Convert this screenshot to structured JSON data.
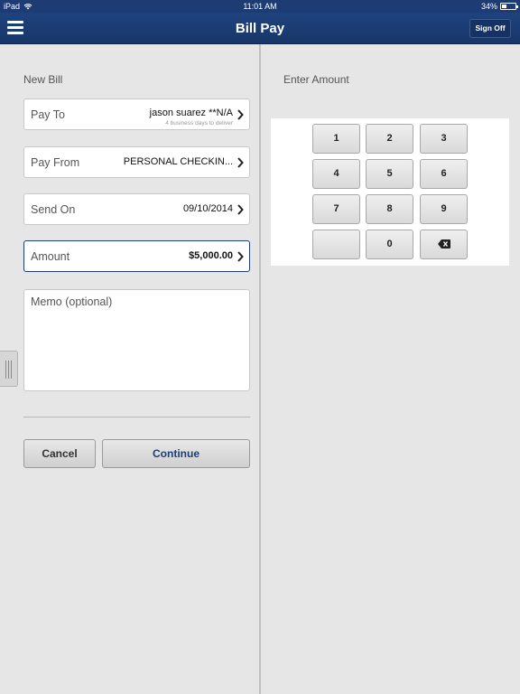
{
  "status_bar": {
    "device": "iPad",
    "time": "11:01 AM",
    "battery_text": "34%",
    "battery_level": 0.34
  },
  "nav": {
    "title": "Bill Pay",
    "sign_off": "Sign Off"
  },
  "left": {
    "section_title": "New Bill",
    "fields": [
      {
        "label": "Pay To",
        "value": "jason suarez **N/A",
        "sub": "4 business days to deliver"
      },
      {
        "label": "Pay From",
        "value": "PERSONAL CHECKIN..."
      },
      {
        "label": "Send On",
        "value": "09/10/2014"
      },
      {
        "label": "Amount",
        "value": "$5,000.00"
      }
    ],
    "memo_placeholder": "Memo (optional)",
    "cancel_label": "Cancel",
    "continue_label": "Continue"
  },
  "right": {
    "section_title": "Enter Amount",
    "keys": [
      "1",
      "2",
      "3",
      "4",
      "5",
      "6",
      "7",
      "8",
      "9",
      "",
      "0",
      "backspace"
    ]
  },
  "colors": {
    "nav_bar": "#1d3c73",
    "active_border": "#1d3c73",
    "continue_text": "#1d3c73"
  }
}
